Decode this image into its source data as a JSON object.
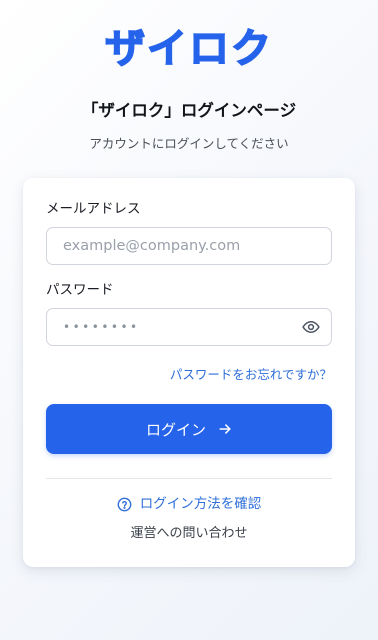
{
  "brand": {
    "logo_text": "ザイロク",
    "accent_color": "#2563eb"
  },
  "header": {
    "title": "「ザイロク」ログインページ",
    "subtitle": "アカウントにログインしてください"
  },
  "form": {
    "email": {
      "label": "メールアドレス",
      "placeholder": "example@company.com",
      "value": ""
    },
    "password": {
      "label": "パスワード",
      "masked_value": "••••••••",
      "toggle_icon": "eye-icon"
    },
    "forgot_password": "パスワードをお忘れですか？",
    "submit_label": "ログイン",
    "submit_icon": "arrow-right-icon"
  },
  "footer": {
    "help_label": "ログイン方法を確認",
    "help_icon": "question-circle-icon",
    "contact_label": "運営への問い合わせ"
  }
}
